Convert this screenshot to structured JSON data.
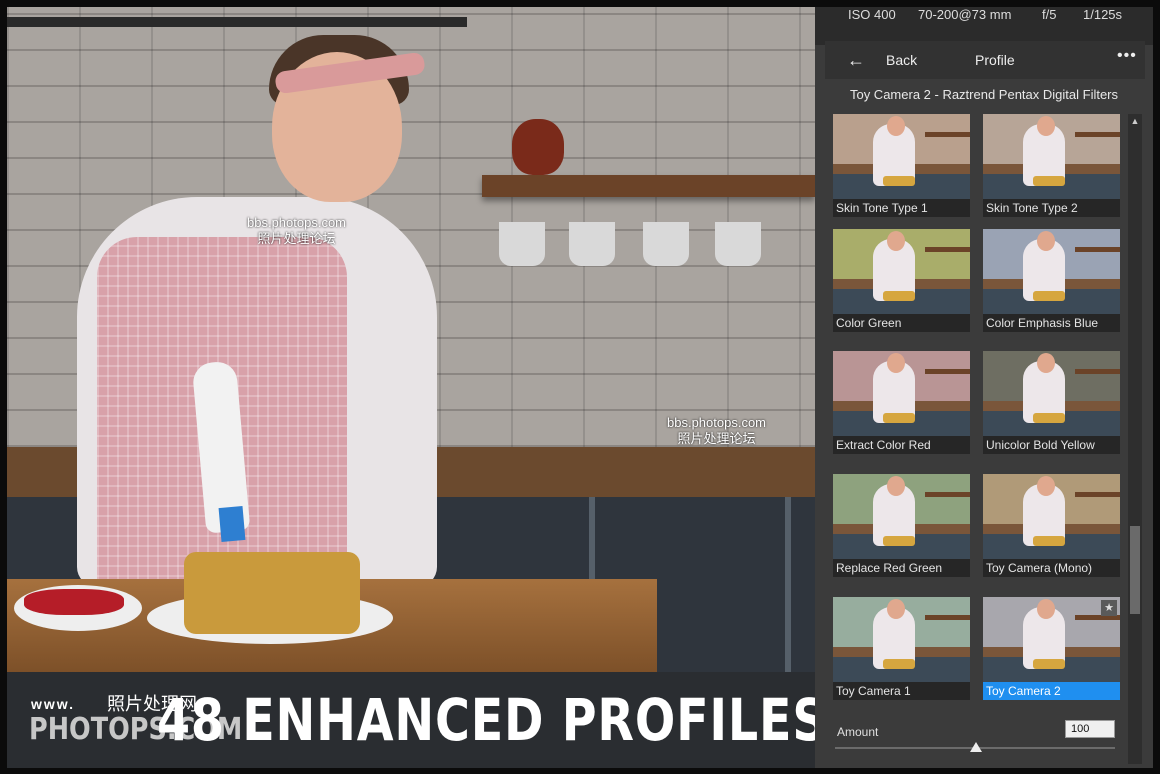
{
  "panel": {
    "exif": {
      "iso": "ISO 400",
      "lens": "70-200@73 mm",
      "aperture": "f/5",
      "shutter": "1/125s"
    },
    "nav": {
      "back_label": "Back",
      "title": "Profile",
      "more_label": "•••"
    },
    "group_title": "Toy Camera 2 - Raztrend Pentax Digital Filters",
    "profiles": [
      {
        "label": "Skin Tone Type 1",
        "tint": "#b9a08d",
        "selected": false
      },
      {
        "label": "Skin Tone Type 2",
        "tint": "#b7a597",
        "selected": false
      },
      {
        "label": "Color Green",
        "tint": "#a9ad6a",
        "selected": false
      },
      {
        "label": "Color Emphasis Blue",
        "tint": "#9aa3b4",
        "selected": false
      },
      {
        "label": "Extract Color Red",
        "tint": "#b99595",
        "selected": false
      },
      {
        "label": "Unicolor Bold Yellow",
        "tint": "#6e6e62",
        "selected": false
      },
      {
        "label": "Replace Red Green",
        "tint": "#8ea27e",
        "selected": false
      },
      {
        "label": "Toy Camera (Mono)",
        "tint": "#b09a78",
        "selected": false
      },
      {
        "label": "Toy Camera 1",
        "tint": "#97ad9e",
        "selected": false
      },
      {
        "label": "Toy Camera 2",
        "tint": "#a8a7ad",
        "selected": true,
        "favorite": true
      }
    ],
    "amount": {
      "label": "Amount",
      "value": "100"
    }
  },
  "banner": {
    "title": "48 ENHANCED PROFILES",
    "logo_www": "www.",
    "logo_cn": "照片处理网",
    "logo_main": "PHOTOPS.COM"
  },
  "watermarks": [
    {
      "line1": "bbs.photops.com",
      "line2": "照片处理论坛"
    },
    {
      "line1": "bbs.photops.com",
      "line2": "照片处理论坛"
    }
  ],
  "colors": {
    "accent": "#1f8ff0",
    "panel_bg": "#3b3b3b",
    "banner_bg": "#2a2d31"
  }
}
